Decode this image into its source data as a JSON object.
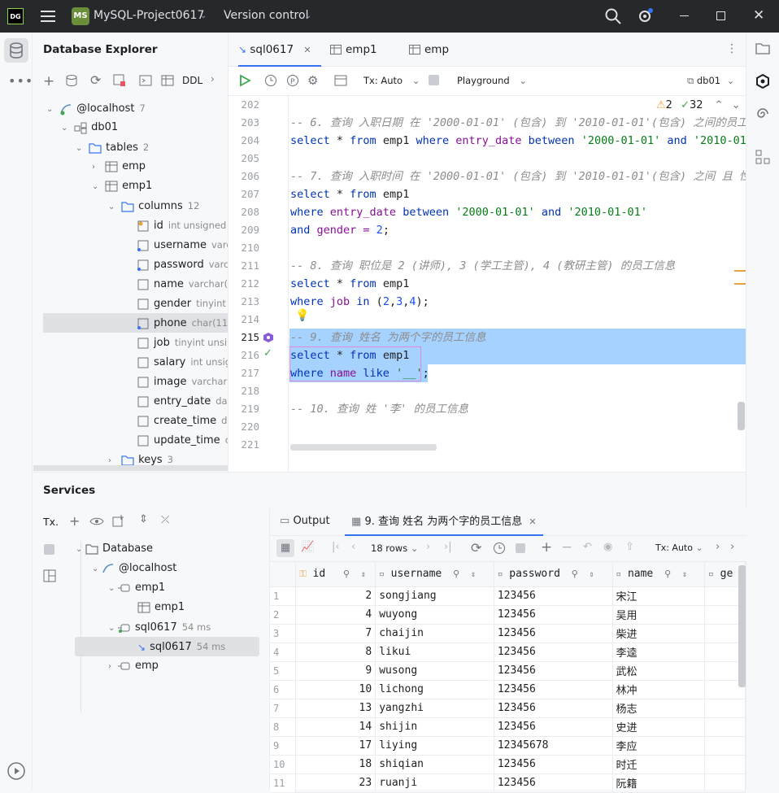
{
  "titlebar": {
    "logo": "DG",
    "project_badge": "MS",
    "project_name": "MySQL-Project0617",
    "vcs": "Version control"
  },
  "explorer": {
    "title": "Database Explorer",
    "ddl_label": "DDL",
    "tree": {
      "host": {
        "label": "@localhost",
        "count": "7"
      },
      "schema": {
        "label": "db01"
      },
      "tables": {
        "label": "tables",
        "count": "2"
      },
      "emp": {
        "label": "emp"
      },
      "emp1": {
        "label": "emp1"
      },
      "columns": {
        "label": "columns",
        "count": "12"
      },
      "cols": [
        {
          "name": "id",
          "type": "int unsigned"
        },
        {
          "name": "username",
          "type": "varc"
        },
        {
          "name": "password",
          "type": "varc"
        },
        {
          "name": "name",
          "type": "varchar("
        },
        {
          "name": "gender",
          "type": "tinyint"
        },
        {
          "name": "phone",
          "type": "char(11"
        },
        {
          "name": "job",
          "type": "tinyint unsi"
        },
        {
          "name": "salary",
          "type": "int unsig"
        },
        {
          "name": "image",
          "type": "varchar("
        },
        {
          "name": "entry_date",
          "type": "da"
        },
        {
          "name": "create_time",
          "type": "d"
        },
        {
          "name": "update_time",
          "type": "c"
        }
      ],
      "keys": {
        "label": "keys",
        "count": "3"
      }
    }
  },
  "editor": {
    "tabs": [
      "sql0617",
      "emp1",
      "emp"
    ],
    "toolbar": {
      "tx": "Tx: Auto",
      "playground": "Playground",
      "db": "db01"
    },
    "inspections": {
      "warnings": "2",
      "ok": "32"
    },
    "line_numbers": [
      "202",
      "203",
      "204",
      "205",
      "206",
      "207",
      "208",
      "209",
      "210",
      "211",
      "212",
      "213",
      "214",
      "215",
      "216",
      "217",
      "218",
      "219",
      "220",
      "221"
    ],
    "lines": {
      "l203": "-- 6. 查询 入职日期 在 '2000-01-01' (包含) 到 '2010-01-01'(包含) 之间的员工信",
      "l204a": "select",
      "l204b": " * ",
      "l204c": "from",
      "l204d": " emp1 ",
      "l204e": "where",
      "l204f": " entry_date ",
      "l204g": "between",
      "l204h": " '2000-01-01' ",
      "l204i": "and",
      "l204j": " '2010-01-",
      "l206": "-- 7. 查询 入职时间 在 '2000-01-01' (包含) 到 '2010-01-01'(包含) 之间 且 性别",
      "l207a": "select",
      "l207b": " * ",
      "l207c": "from",
      "l207d": " emp1",
      "l208a": "where",
      "l208b": " entry_date ",
      "l208c": "between",
      "l208d": " '2000-01-01' ",
      "l208e": "and",
      "l208f": " '2010-01-01'",
      "l209a": "and",
      "l209b": " gender = ",
      "l209c": "2",
      "l209d": ";",
      "l211": "-- 8. 查询 职位是 2 (讲师), 3 (学工主管), 4 (教研主管) 的员工信息",
      "l212a": "select",
      "l212b": " * ",
      "l212c": "from",
      "l212d": " emp1",
      "l213a": "where",
      "l213b": " job ",
      "l213c": "in",
      "l213d": " (",
      "l213e": "2",
      "l213f": ",",
      "l213g": "3",
      "l213h": ",",
      "l213i": "4",
      "l213j": ");",
      "l215": "-- 9. 查询 姓名 为两个字的员工信息",
      "l216a": "select",
      "l216b": " * ",
      "l216c": "from",
      "l216d": " emp1",
      "l217a": "where",
      "l217b": " name ",
      "l217c": "like",
      "l217d": " '__'",
      "l217e": ";",
      "l219": "-- 10. 查询 姓 '李' 的员工信息"
    }
  },
  "services": {
    "title": "Services",
    "tx_label": "Tx.",
    "tree": [
      {
        "label": "Database"
      },
      {
        "label": "@localhost"
      },
      {
        "label": "emp1"
      },
      {
        "label": "emp1"
      },
      {
        "label": "sql0617",
        "time": "54 ms"
      },
      {
        "label": "sql0617",
        "time": "54 ms"
      },
      {
        "label": "emp"
      }
    ],
    "result_tabs": {
      "output": "Output",
      "query": "9. 查询 姓名 为两个字的员工信息"
    },
    "result_toolbar": {
      "rows": "18 rows",
      "tx": "Tx: Auto"
    },
    "columns": [
      "id",
      "username",
      "password",
      "name",
      "ge"
    ],
    "rows": [
      [
        "1",
        "2",
        "songjiang",
        "123456",
        "宋江"
      ],
      [
        "2",
        "4",
        "wuyong",
        "123456",
        "吴用"
      ],
      [
        "3",
        "7",
        "chaijin",
        "123456",
        "柴进"
      ],
      [
        "4",
        "8",
        "likui",
        "123456",
        "李逵"
      ],
      [
        "5",
        "9",
        "wusong",
        "123456",
        "武松"
      ],
      [
        "6",
        "10",
        "lichong",
        "123456",
        "林冲"
      ],
      [
        "7",
        "13",
        "yangzhi",
        "123456",
        "杨志"
      ],
      [
        "8",
        "14",
        "shijin",
        "123456",
        "史进"
      ],
      [
        "9",
        "17",
        "liying",
        "12345678",
        "李应"
      ],
      [
        "10",
        "18",
        "shiqian",
        "123456",
        "时迁"
      ],
      [
        "11",
        "23",
        "ruanji",
        "123456",
        "阮籍"
      ]
    ]
  }
}
